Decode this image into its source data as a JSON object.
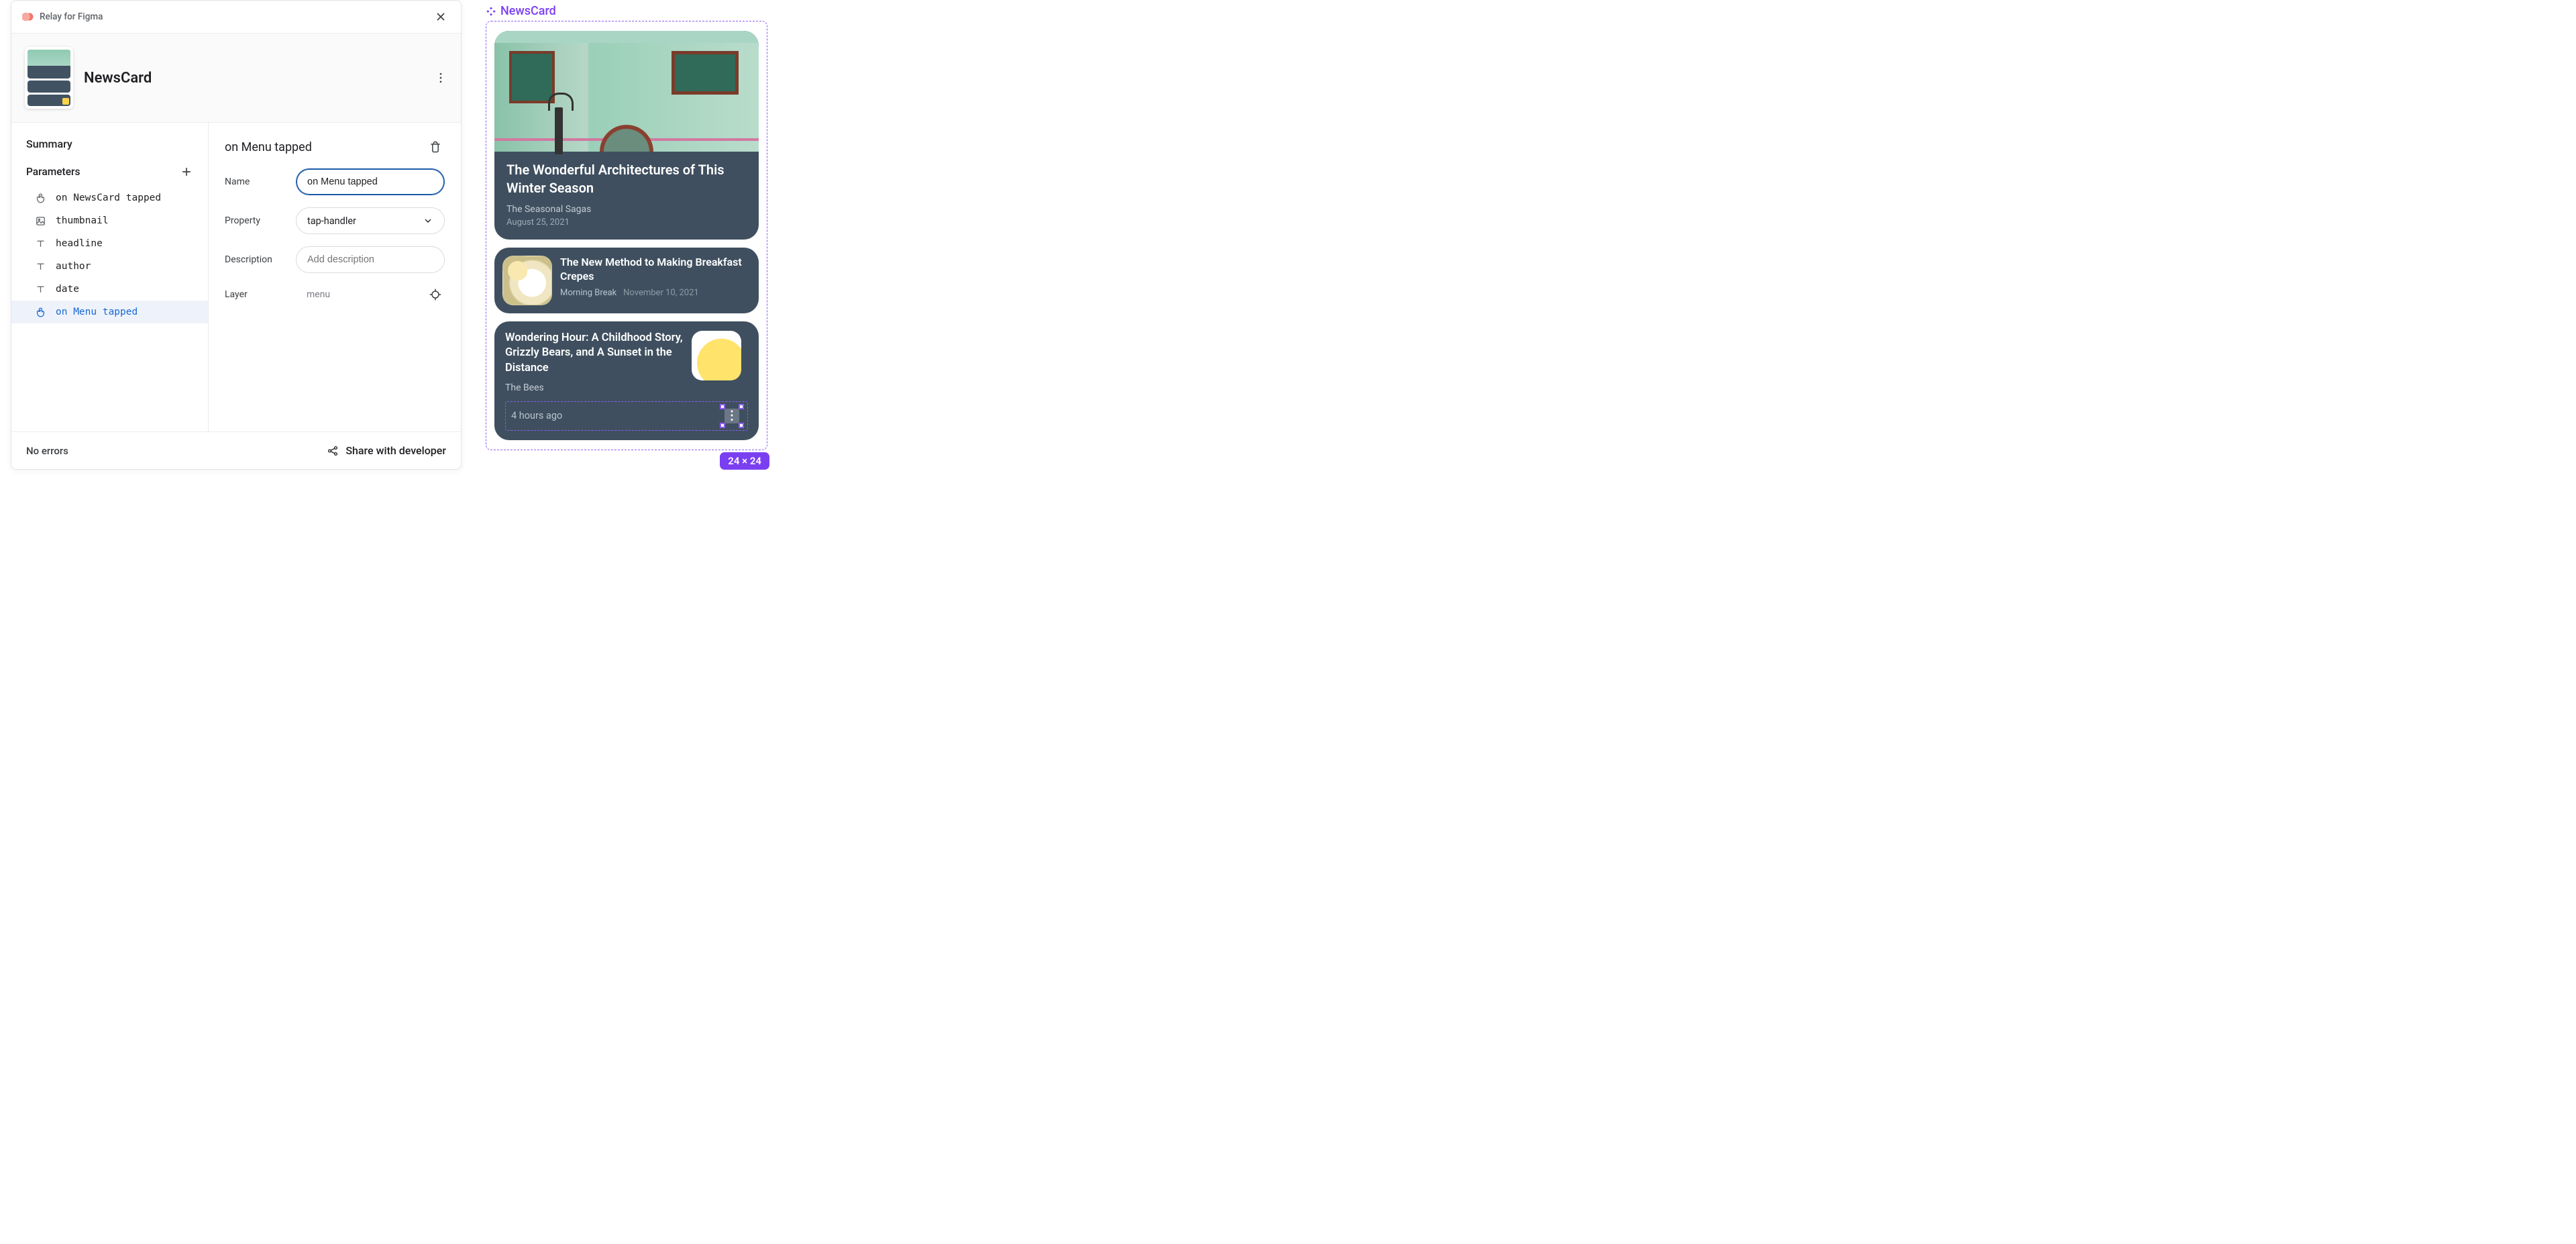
{
  "plugin": {
    "name": "Relay for Figma"
  },
  "component": {
    "title": "NewsCard"
  },
  "sidebar": {
    "summary_label": "Summary",
    "parameters_label": "Parameters",
    "params": [
      {
        "icon": "tap",
        "label": "on NewsCard tapped"
      },
      {
        "icon": "image",
        "label": "thumbnail"
      },
      {
        "icon": "text",
        "label": "headline"
      },
      {
        "icon": "text",
        "label": "author"
      },
      {
        "icon": "text",
        "label": "date"
      },
      {
        "icon": "tap",
        "label": "on Menu tapped"
      }
    ],
    "selected_index": 5
  },
  "detail": {
    "title": "on Menu tapped",
    "fields": {
      "name_label": "Name",
      "name_value": "on Menu tapped",
      "property_label": "Property",
      "property_value": "tap-handler",
      "description_label": "Description",
      "description_placeholder": "Add description",
      "layer_label": "Layer",
      "layer_value": "menu"
    }
  },
  "footer": {
    "status": "No errors",
    "share_label": "Share with developer"
  },
  "canvas": {
    "frame_label": "NewsCard",
    "size_badge": "24 × 24",
    "cards": [
      {
        "headline": "The Wonderful Architectures of This Winter Season",
        "author": "The Seasonal Sagas",
        "date": "August 25, 2021"
      },
      {
        "headline": "The New Method to Making Breakfast Crepes",
        "author": "Morning Break",
        "date": "November 10, 2021"
      },
      {
        "headline": "Wondering Hour: A Childhood Story, Grizzly Bears, and A Sunset in the Distance",
        "author": "The Bees",
        "date": "4 hours ago"
      }
    ]
  }
}
